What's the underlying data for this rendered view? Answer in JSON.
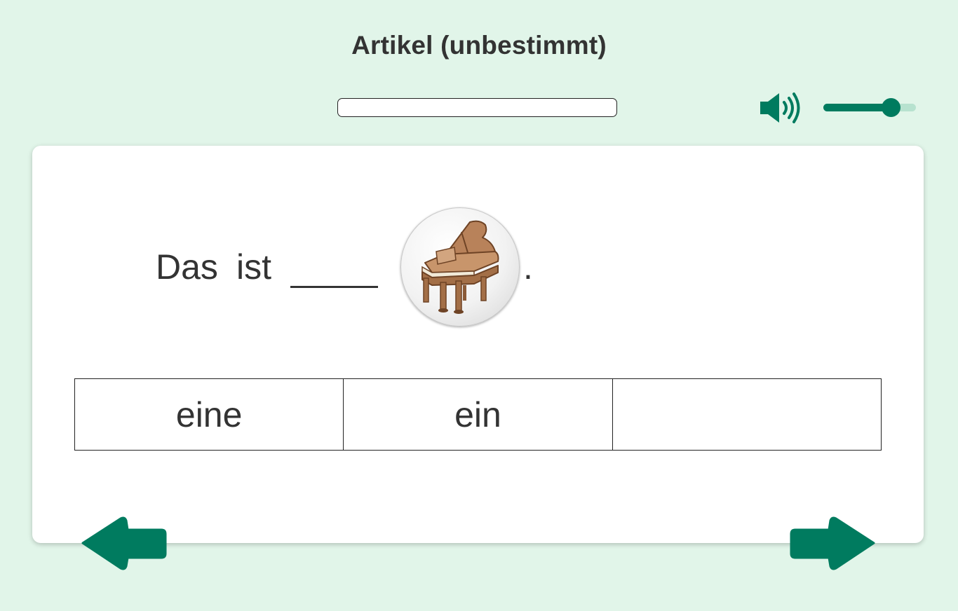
{
  "header": {
    "title": "Artikel (unbestimmt)"
  },
  "progress": {
    "value": 0
  },
  "audio": {
    "speaker_icon": "speaker-volume-icon",
    "volume_level": 0.73
  },
  "exercise": {
    "words": [
      "Das",
      "ist"
    ],
    "blank": "_____",
    "picture_icon": "grand-piano-icon",
    "terminal": ".",
    "choices": [
      "eine",
      "ein",
      ""
    ]
  },
  "navigation": {
    "prev_icon": "arrow-left-icon",
    "next_icon": "arrow-right-icon"
  },
  "colors": {
    "background": "#e1f5e9",
    "accent": "#007b5f",
    "track": "#b7e2cf",
    "card": "#ffffff",
    "text": "#333333"
  }
}
